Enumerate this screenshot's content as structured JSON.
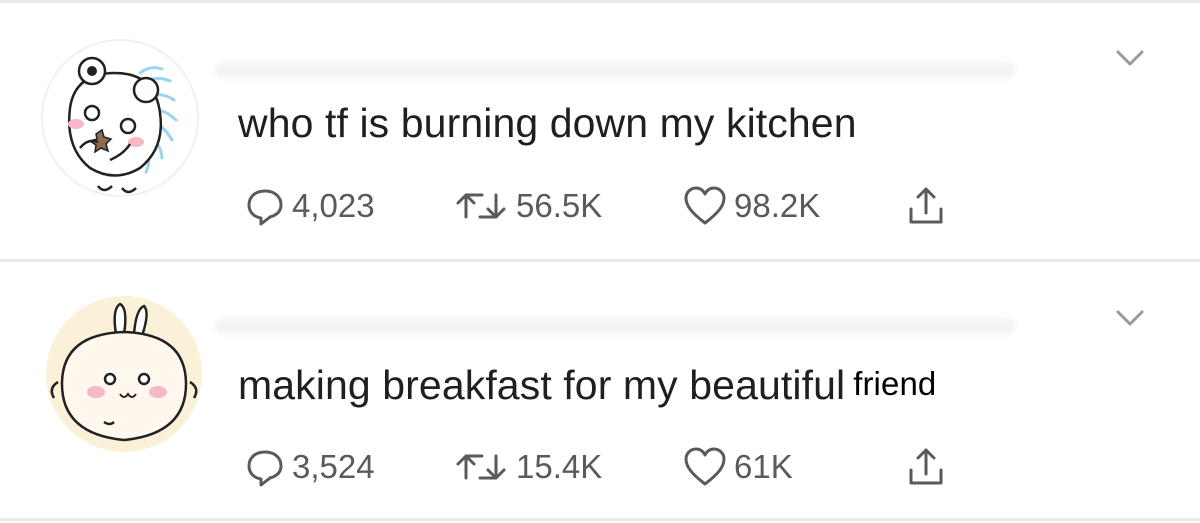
{
  "colors": {
    "divider": "#e9e9e9",
    "text": "#1f1f1f",
    "meta": "#5a5a5a",
    "avatar_bg_1": "#ffffff",
    "avatar_bg_2": "#fbf1d9"
  },
  "tweets": [
    {
      "avatar_icon": "hamster-avatar-icon",
      "text": "who tf is burning down my kitchen",
      "appended_text": "",
      "replies": "4,023",
      "retweets": "56.5K",
      "likes": "98.2K"
    },
    {
      "avatar_icon": "rabbit-avatar-icon",
      "text": "making breakfast for my beautiful",
      "appended_text": "friend",
      "replies": "3,524",
      "retweets": "15.4K",
      "likes": "61K"
    }
  ]
}
